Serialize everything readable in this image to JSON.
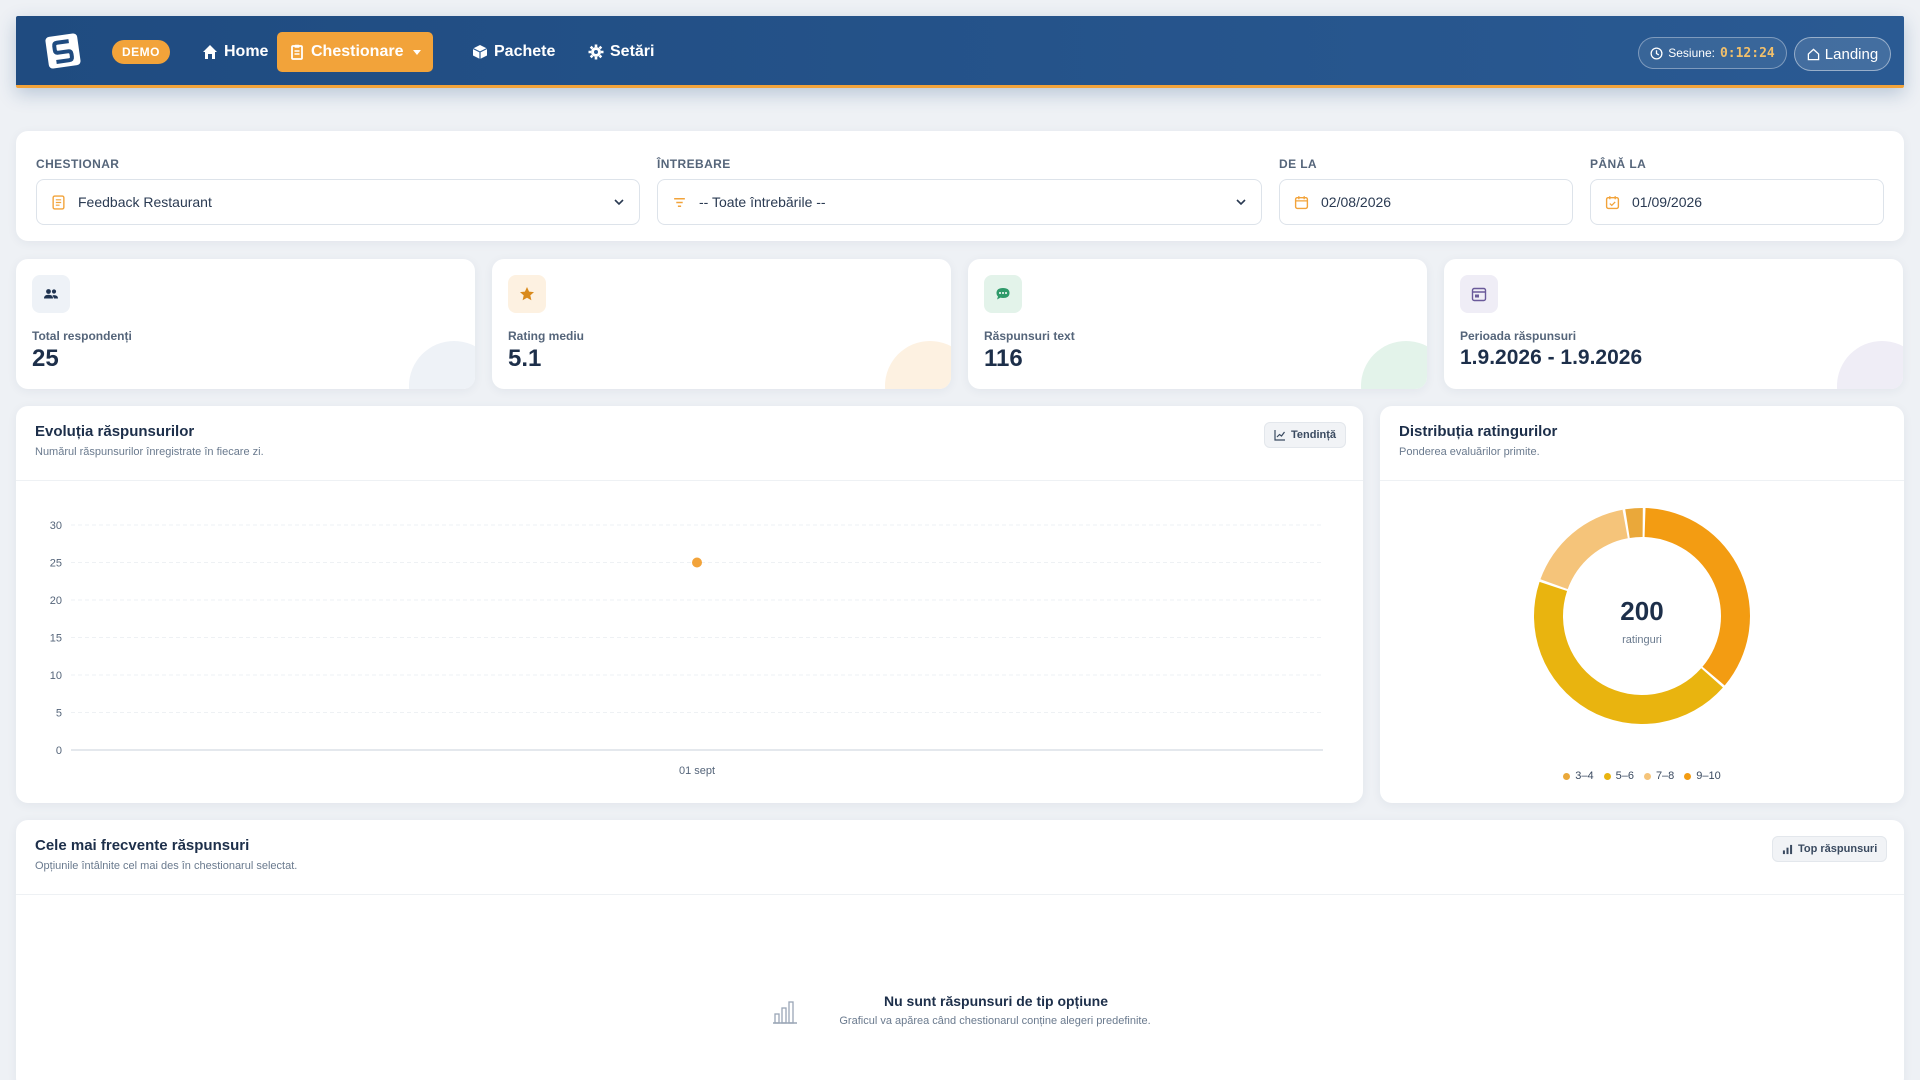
{
  "navbar": {
    "demo_label": "DEMO",
    "items": [
      {
        "label": "Home",
        "icon": "home-icon"
      },
      {
        "label": "Chestionare",
        "icon": "clipboard-icon",
        "active": true
      },
      {
        "label": "Pachete",
        "icon": "box-icon"
      },
      {
        "label": "Setări",
        "icon": "gear-icon"
      }
    ],
    "session_label": "Sesiune:",
    "session_time": "0:12:24",
    "landing_label": "Landing"
  },
  "filters": {
    "chestionar": {
      "label": "CHESTIONAR",
      "value": "Feedback Restaurant"
    },
    "intrebare": {
      "label": "ÎNTREBARE",
      "value": "-- Toate întrebările --"
    },
    "de_la": {
      "label": "DE LA",
      "value": "02/08/2026"
    },
    "pana_la": {
      "label": "PÂNĂ LA",
      "value": "01/09/2026"
    }
  },
  "stats": [
    {
      "label": "Total respondenți",
      "value": "25",
      "icon": "users-icon",
      "color": "#1f4b80"
    },
    {
      "label": "Rating mediu",
      "value": "5.1",
      "icon": "star-icon",
      "color": "#f2a33a"
    },
    {
      "label": "Răspunsuri text",
      "value": "116",
      "icon": "chat-icon",
      "color": "#2f9a6a"
    },
    {
      "label": "Perioada răspunsuri",
      "value": "1.9.2026 - 1.9.2026",
      "icon": "calendar-icon",
      "color": "#6a5a9a"
    }
  ],
  "evolution": {
    "title": "Evoluția răspunsurilor",
    "subtitle": "Numărul răspunsurilor înregistrate în fiecare zi.",
    "button_label": "Tendință"
  },
  "distribution": {
    "title": "Distribuția ratingurilor",
    "subtitle": "Ponderea evaluărilor primite.",
    "total": "200",
    "total_label": "ratinguri"
  },
  "frequent": {
    "title": "Cele mai frecvente răspunsuri",
    "subtitle": "Opțiunile întâlnite cel mai des în chestionarul selectat.",
    "button_label": "Top răspunsuri",
    "empty_title": "Nu sunt răspunsuri de tip opțiune",
    "empty_subtitle": "Graficul va apărea când chestionarul conține alegeri predefinite."
  },
  "chart_data": [
    {
      "type": "line",
      "x": [
        "01 sept"
      ],
      "series": [
        {
          "values": [
            25
          ]
        }
      ],
      "yticks": [
        0,
        5,
        10,
        15,
        20,
        25,
        30
      ],
      "ylim": [
        0,
        30
      ],
      "grid": true,
      "color": "#f2a33a"
    },
    {
      "type": "pie",
      "categories": [
        "3–4",
        "5–6",
        "7–8",
        "9–10"
      ],
      "values": [
        6,
        88,
        34,
        72
      ],
      "colors": [
        "#eaa83a",
        "#e9b40f",
        "#f5c47a",
        "#f39c12"
      ],
      "legend": "bottom"
    }
  ]
}
